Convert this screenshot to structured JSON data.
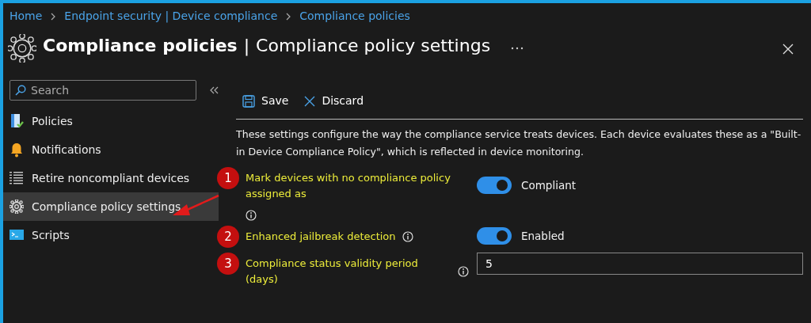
{
  "breadcrumb": [
    {
      "label": "Home"
    },
    {
      "label": "Endpoint security | Device compliance"
    },
    {
      "label": "Compliance policies"
    }
  ],
  "header": {
    "title": "Compliance policies",
    "separator": "|",
    "subtitle": "Compliance policy settings"
  },
  "sidebar": {
    "search": {
      "placeholder": "Search"
    },
    "items": [
      {
        "label": "Policies",
        "selected": false
      },
      {
        "label": "Notifications",
        "selected": false
      },
      {
        "label": "Retire noncompliant devices",
        "selected": false
      },
      {
        "label": "Compliance policy settings",
        "selected": true
      },
      {
        "label": "Scripts",
        "selected": false
      }
    ]
  },
  "toolbar": [
    {
      "label": "Save"
    },
    {
      "label": "Discard"
    }
  ],
  "description": "These settings configure the way the compliance service treats devices. Each device evaluates these as a \"Built-in Device Compliance Policy\", which is reflected in device monitoring.",
  "settings": [
    {
      "number": "1",
      "label": "Mark devices with no compliance policy assigned as",
      "kind": "toggle",
      "on": true,
      "value": "Compliant"
    },
    {
      "number": "2",
      "label": "Enhanced jailbreak detection",
      "kind": "toggle",
      "on": true,
      "value": "Enabled"
    },
    {
      "number": "3",
      "label": "Compliance status validity period (days)",
      "kind": "input",
      "value": "5"
    }
  ]
}
